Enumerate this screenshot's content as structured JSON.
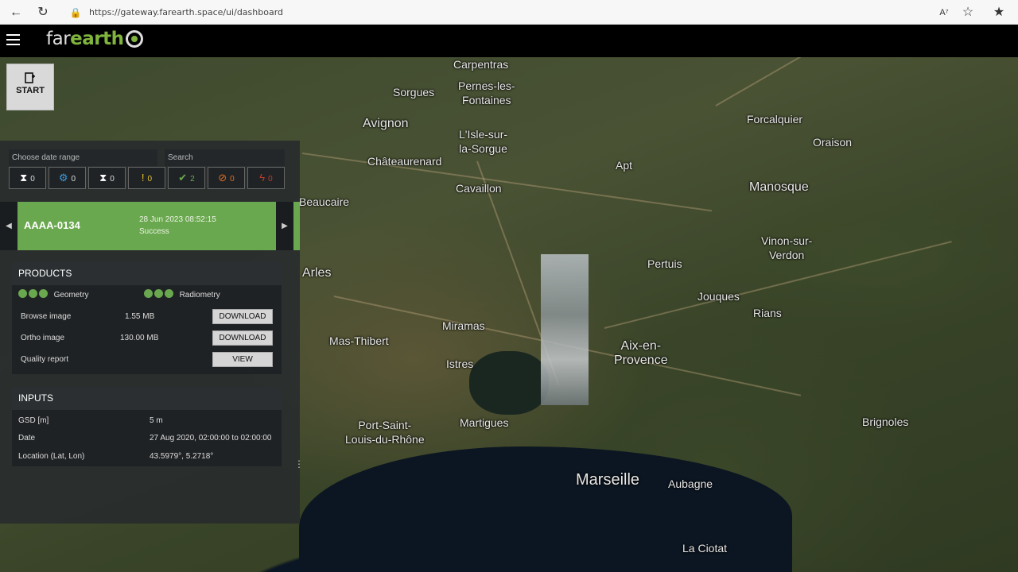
{
  "browser": {
    "url": "https://gateway.farearth.space/ui/dashboard"
  },
  "header": {
    "logo_far": "far",
    "logo_earth": "earth"
  },
  "start": {
    "label": "START"
  },
  "filters": {
    "date_label": "Choose date range",
    "search_label": "Search",
    "items": [
      {
        "icon": "hourglass-icon",
        "count": "0",
        "color": "#ffffff"
      },
      {
        "icon": "gear-icon",
        "count": "0",
        "color": "#3b9ddd"
      },
      {
        "icon": "hourglass-icon",
        "count": "0",
        "color": "#ffffff"
      },
      {
        "icon": "warning-icon",
        "count": "0",
        "color": "#e6c229"
      },
      {
        "icon": "check-icon",
        "count": "2",
        "color": "#6aa84f"
      },
      {
        "icon": "cancel-icon",
        "count": "0",
        "color": "#e06c1f"
      },
      {
        "icon": "bolt-icon",
        "count": "0",
        "color": "#c0392b"
      }
    ]
  },
  "task": {
    "id": "AAAA-0134",
    "date": "28 Jun 2023 08:52:15",
    "status": "Success"
  },
  "products": {
    "title": "PRODUCTS",
    "geometry": "Geometry",
    "radiometry": "Radiometry",
    "rows": [
      {
        "label": "Browse image",
        "size": "1.55 MB",
        "action": "DOWNLOAD"
      },
      {
        "label": "Ortho image",
        "size": "130.00 MB",
        "action": "DOWNLOAD"
      },
      {
        "label": "Quality report",
        "size": "",
        "action": "VIEW"
      }
    ]
  },
  "inputs": {
    "title": "INPUTS",
    "rows": [
      {
        "label": "GSD [m]",
        "value": "5 m"
      },
      {
        "label": "Date",
        "value": "27 Aug 2020, 02:00:00 to 02:00:00"
      },
      {
        "label": "Location (Lat, Lon)",
        "value": "43.5979°, 5.2718°"
      }
    ]
  },
  "map": {
    "places": [
      "Carpentras",
      "Sorgues",
      "Pernes-les-\nFontaines",
      "Avignon",
      "L'Isle-sur-\nla-Sorgue",
      "Forcalquier",
      "Oraison",
      "Châteaurenard",
      "Apt",
      "Cavaillon",
      "Manosque",
      "Beaucaire",
      "Vinon-sur-\nVerdon",
      "Pertuis",
      "Arles",
      "Jouques",
      "Rians",
      "Miramas",
      "Mas-Thibert",
      "Aix-en-\nProvence",
      "Istres",
      "Port-Saint-\nLouis-du-Rhône",
      "Martigues",
      "Brignoles",
      "Marseille",
      "Aubagne",
      "La Ciotat"
    ]
  }
}
